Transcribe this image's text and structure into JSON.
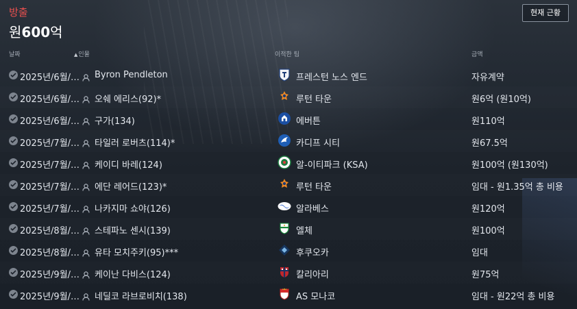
{
  "header": {
    "title": "방출",
    "value_prefix": "원",
    "value_amount": "600",
    "value_suffix": "억"
  },
  "buttons": {
    "current_status": "현재 근황"
  },
  "columns": {
    "date": "날짜",
    "person": "인물",
    "team": "이적한 팀",
    "fee": "금액"
  },
  "colors": {
    "accent_red": "#e8504e"
  },
  "rows": [
    {
      "date": "2025년/6월/…",
      "name": "Byron Pendleton",
      "team": "프레스턴 노스 엔드",
      "fee": "자유계약",
      "crest": "preston-crest-icon"
    },
    {
      "date": "2025년/6월/…",
      "name": "오쉐 에리스(92)*",
      "team": "루턴 타운",
      "fee": "원6억 (원10억)",
      "crest": "luton-crest-icon"
    },
    {
      "date": "2025년/6월/…",
      "name": "구가(134)",
      "team": "에버튼",
      "fee": "원110억",
      "crest": "everton-crest-icon"
    },
    {
      "date": "2025년/7월/…",
      "name": "타일러 로버츠(114)*",
      "team": "카디프 시티",
      "fee": "원67.5억",
      "crest": "cardiff-crest-icon"
    },
    {
      "date": "2025년/7월/…",
      "name": "케이디 바레(124)",
      "team": "알-이티파크 (KSA)",
      "fee": "원100억 (원130억)",
      "crest": "al-ettifaq-crest-icon"
    },
    {
      "date": "2025년/7월/…",
      "name": "에단 레어드(123)*",
      "team": "루턴 타운",
      "fee": "임대 - 원1.35억 총 비용",
      "crest": "luton-crest-icon"
    },
    {
      "date": "2025년/7월/…",
      "name": "나카지마 쇼야(126)",
      "team": "알라베스",
      "fee": "원120억",
      "crest": "alaves-crest-icon"
    },
    {
      "date": "2025년/8월/…",
      "name": "스테파노 센시(139)",
      "team": "엘체",
      "fee": "원100억",
      "crest": "elche-crest-icon"
    },
    {
      "date": "2025년/8월/…",
      "name": "유타 모치주키(95)***",
      "team": "후쿠오카",
      "fee": "임대",
      "crest": "fukuoka-crest-icon"
    },
    {
      "date": "2025년/9월/…",
      "name": "케이난 다비스(124)",
      "team": "칼리아리",
      "fee": "원75억",
      "crest": "cagliari-crest-icon"
    },
    {
      "date": "2025년/9월/…",
      "name": "네딜코 라브로비치(138)",
      "team": "AS 모나코",
      "fee": "임대 - 원22억 총 비용",
      "crest": "monaco-crest-icon"
    }
  ]
}
